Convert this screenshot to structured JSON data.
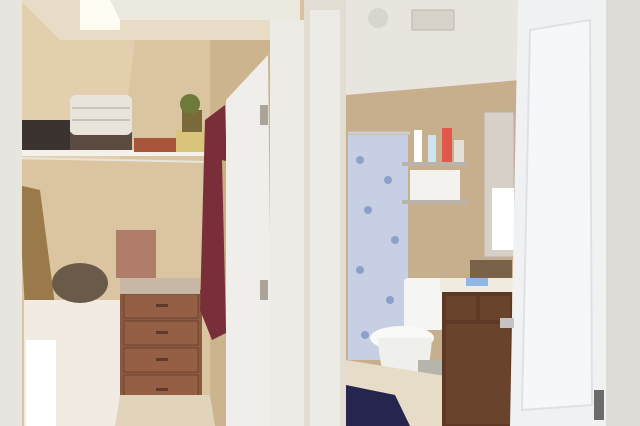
{
  "scene": {
    "subject": "photo",
    "colors": {
      "closet_wall": "#dcc6a2",
      "bath_wall": "#c9b08f",
      "trim": "#ece9e1",
      "door_white": "#f2f2f4",
      "drawer_wood": "#8a5a40",
      "vanity_wood": "#5e3a26",
      "robe": "#7a2e3a",
      "curtain": "#c7cfe4",
      "rug": "#2a2a52"
    }
  }
}
